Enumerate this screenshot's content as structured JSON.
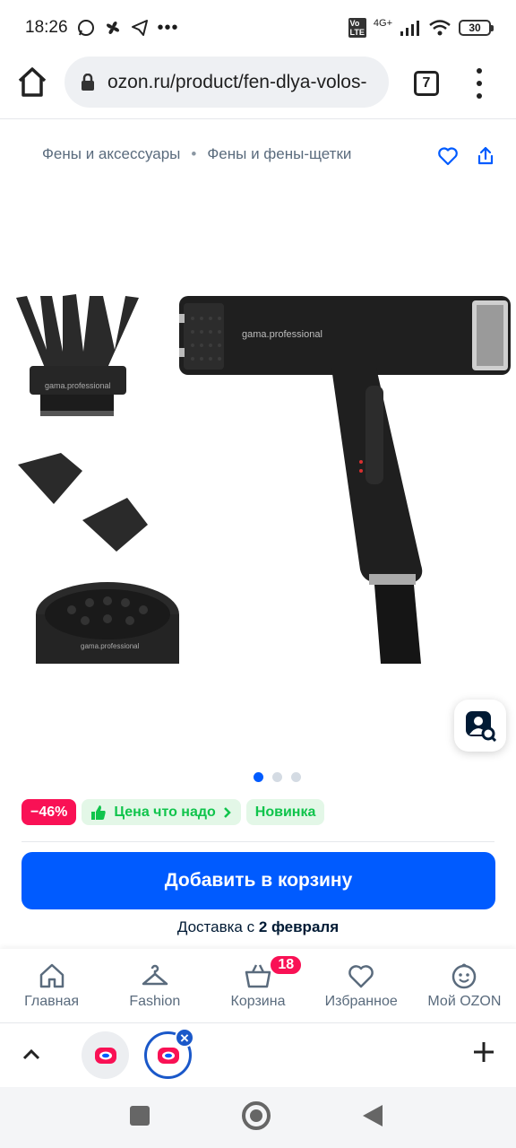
{
  "status_bar": {
    "time": "18:26",
    "network": "4G+",
    "battery": "30"
  },
  "browser": {
    "url": "ozon.ru/product/fen-dlya-volos-",
    "tab_count": "7"
  },
  "breadcrumb": {
    "items": [
      "Фены и аксессуары",
      "Фены и фены-щетки"
    ]
  },
  "product": {
    "brand_on_device": "gama.professional",
    "gallery_total": 3,
    "gallery_active": 1
  },
  "badges": {
    "discount": "−46%",
    "good_price": "Цена что надо",
    "new": "Новинка"
  },
  "cta": {
    "add_to_cart": "Добавить в корзину",
    "delivery_prefix": "Доставка с ",
    "delivery_date": "2 февраля"
  },
  "bottom_nav": {
    "home": "Главная",
    "fashion": "Fashion",
    "cart": "Корзина",
    "cart_count": "18",
    "favorites": "Избранное",
    "profile": "Мой OZON"
  },
  "colors": {
    "accent": "#005bff",
    "discount": "#f91155",
    "green": "#10c44c"
  }
}
